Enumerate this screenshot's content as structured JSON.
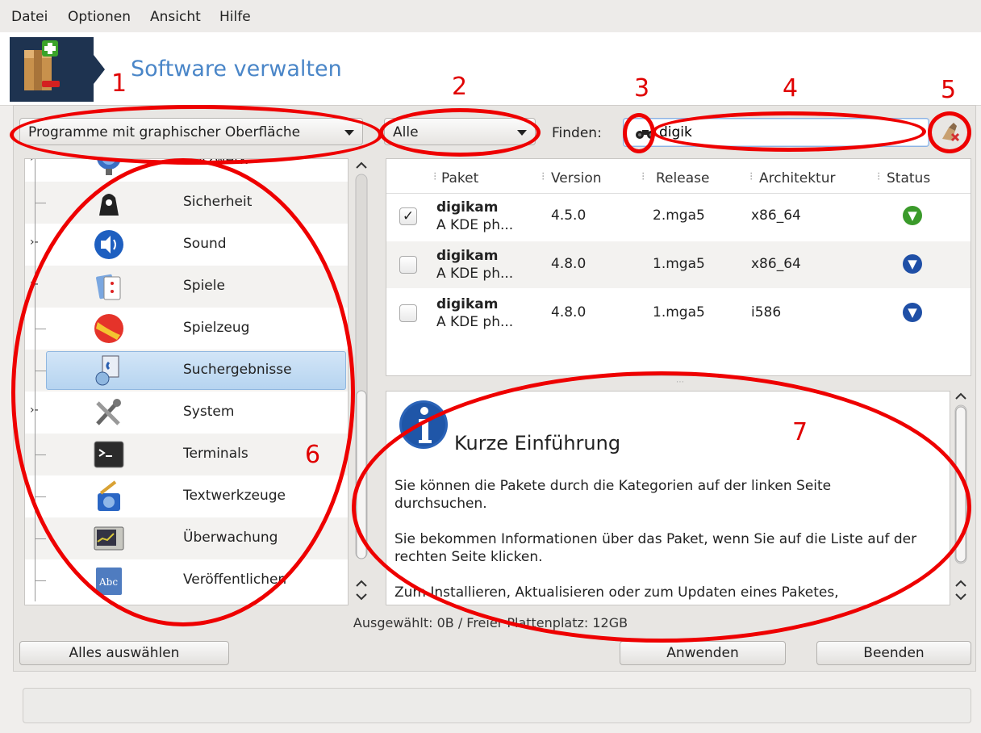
{
  "menubar": {
    "items": [
      "Datei",
      "Optionen",
      "Ansicht",
      "Hilfe"
    ]
  },
  "header": {
    "title": "Software verwalten"
  },
  "filters": {
    "type_combo": "Programme mit graphischer Oberfläche",
    "state_combo": "Alle",
    "find_label": "Finden:",
    "search_value": "digik"
  },
  "categories": [
    {
      "label": "Netzwerk",
      "icon": "network-icon",
      "expandable": true
    },
    {
      "label": "Sicherheit",
      "icon": "security-icon",
      "expandable": false
    },
    {
      "label": "Sound",
      "icon": "sound-icon",
      "expandable": true
    },
    {
      "label": "Spiele",
      "icon": "games-icon",
      "expandable": true
    },
    {
      "label": "Spielzeug",
      "icon": "toys-icon",
      "expandable": false
    },
    {
      "label": "Suchergebnisse",
      "icon": "search-results-icon",
      "expandable": false,
      "selected": true
    },
    {
      "label": "System",
      "icon": "system-icon",
      "expandable": true
    },
    {
      "label": "Terminals",
      "icon": "terminal-icon",
      "expandable": false
    },
    {
      "label": "Textwerkzeuge",
      "icon": "text-tools-icon",
      "expandable": false
    },
    {
      "label": "Überwachung",
      "icon": "monitoring-icon",
      "expandable": false
    },
    {
      "label": "Veröffentlichen",
      "icon": "publishing-icon",
      "expandable": false
    }
  ],
  "table": {
    "columns": [
      "Paket",
      "Version",
      "Release",
      "Architektur",
      "Status"
    ],
    "rows": [
      {
        "name": "digikam",
        "desc": "A KDE ph...",
        "version": "4.5.0",
        "release": "2.mga5",
        "arch": "x86_64",
        "checked": true,
        "status_icon": "installed-icon",
        "status_color": "#3a9a2a"
      },
      {
        "name": "digikam",
        "desc": "A KDE ph...",
        "version": "4.8.0",
        "release": "1.mga5",
        "arch": "x86_64",
        "checked": false,
        "status_icon": "download-icon",
        "status_color": "#1f4fa6"
      },
      {
        "name": "digikam",
        "desc": "A KDE ph...",
        "version": "4.8.0",
        "release": "1.mga5",
        "arch": "i586",
        "checked": false,
        "status_icon": "download-icon",
        "status_color": "#1f4fa6"
      }
    ]
  },
  "info": {
    "title": "Kurze Einführung",
    "paragraphs": [
      "Sie können die Pakete durch die Kategorien auf der linken Seite durchsuchen.",
      "Sie bekommen Informationen über das Paket, wenn Sie auf die Liste auf der rechten Seite klicken.",
      "Zum Installieren, Aktualisieren oder zum Updaten eines Paketes,"
    ]
  },
  "status_text": "Ausgewählt: 0B / Freier Plattenplatz: 12GB",
  "buttons": {
    "select_all": "Alles auswählen",
    "apply": "Anwenden",
    "quit": "Beenden"
  },
  "annotations": [
    "1",
    "2",
    "3",
    "4",
    "5",
    "6",
    "7"
  ],
  "colors": {
    "annotation": "#ee0000",
    "title": "#4a86c8",
    "selection": "#b6d4f0"
  }
}
